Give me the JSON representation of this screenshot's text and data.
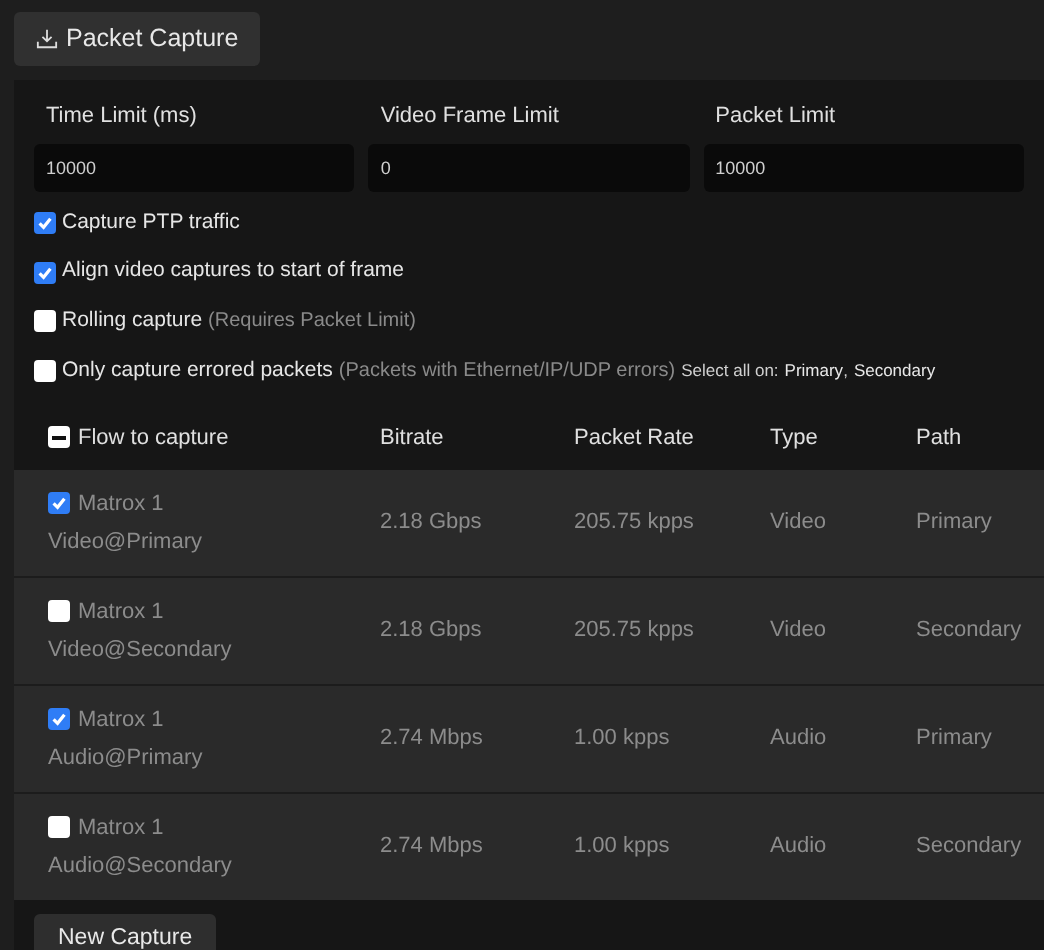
{
  "capture_button": {
    "label": "Packet Capture"
  },
  "limits": [
    {
      "label": "Time Limit (ms)",
      "value": "10000"
    },
    {
      "label": "Video Frame Limit",
      "value": "0"
    },
    {
      "label": "Packet Limit",
      "value": "10000"
    }
  ],
  "options": [
    {
      "label": "Capture PTP traffic",
      "checked": true
    },
    {
      "label": "Align video captures to start of frame",
      "checked": true
    },
    {
      "label": "Rolling capture",
      "note": "(Requires Packet Limit)",
      "checked": false
    },
    {
      "label": "Only capture errored packets",
      "note": "(Packets with Ethernet/IP/UDP errors)",
      "checked": false
    }
  ],
  "select_all": {
    "label": "Select all on:",
    "links": [
      "Primary",
      "Secondary"
    ],
    "separator": ","
  },
  "table": {
    "header_checkbox": {
      "mixed": true
    },
    "columns": [
      "Flow to capture",
      "Bitrate",
      "Packet Rate",
      "Type",
      "Path"
    ],
    "rows": [
      {
        "checked": true,
        "flow": [
          "Matrox 1",
          "Video@Primary"
        ],
        "bitrate": "2.18 Gbps",
        "packet_rate": "205.75 kpps",
        "type": "Video",
        "path": "Primary"
      },
      {
        "checked": false,
        "flow": [
          "Matrox 1",
          "Video@Secondary"
        ],
        "bitrate": "2.18 Gbps",
        "packet_rate": "205.75 kpps",
        "type": "Video",
        "path": "Secondary"
      },
      {
        "checked": true,
        "flow": [
          "Matrox 1",
          "Audio@Primary"
        ],
        "bitrate": "2.74 Mbps",
        "packet_rate": "1.00 kpps",
        "type": "Audio",
        "path": "Primary"
      },
      {
        "checked": false,
        "flow": [
          "Matrox 1",
          "Audio@Secondary"
        ],
        "bitrate": "2.74 Mbps",
        "packet_rate": "1.00 kpps",
        "type": "Audio",
        "path": "Secondary"
      }
    ]
  },
  "new_capture_button": {
    "label": "New Capture"
  }
}
